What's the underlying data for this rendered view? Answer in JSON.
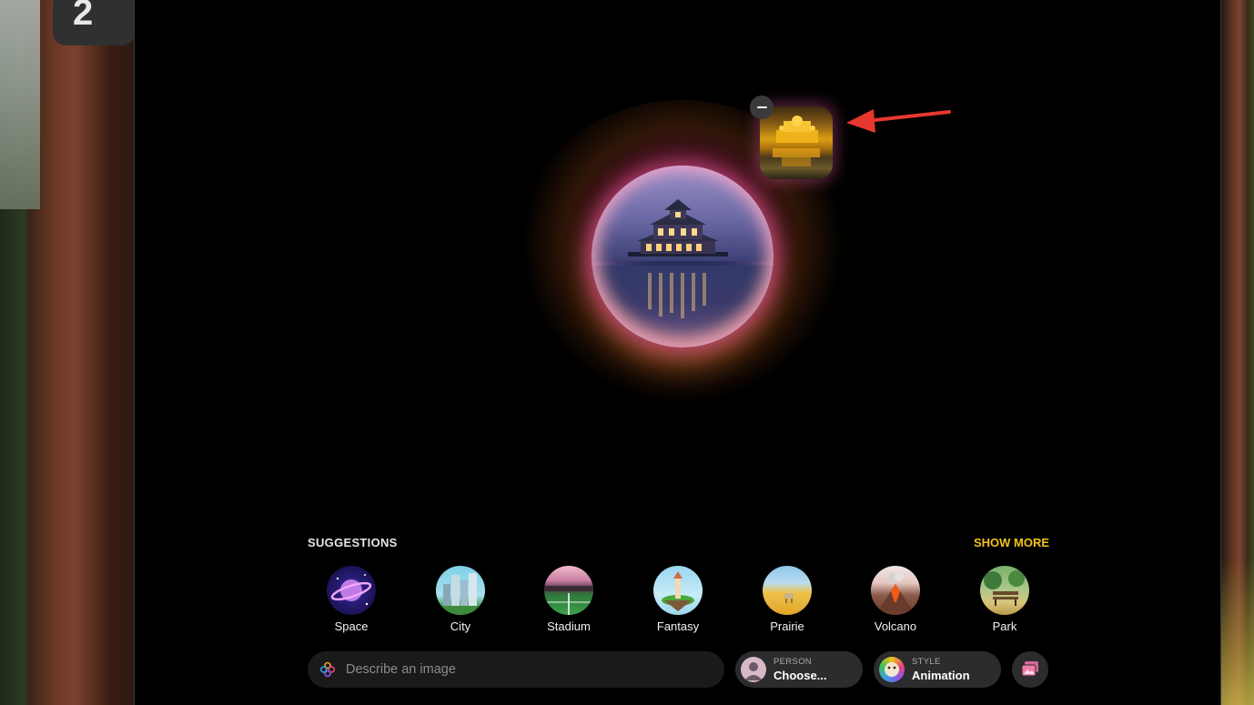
{
  "desktop": {
    "dock_tile_glyph": "2"
  },
  "composer": {
    "remove_reference_icon": "minus-icon",
    "reference_image_icon": "golden-temple-thumbnail"
  },
  "suggestions": {
    "heading": "SUGGESTIONS",
    "show_more_label": "SHOW MORE",
    "items": [
      {
        "label": "Space",
        "icon": "planet-icon"
      },
      {
        "label": "City",
        "icon": "city-icon"
      },
      {
        "label": "Stadium",
        "icon": "stadium-icon"
      },
      {
        "label": "Fantasy",
        "icon": "fantasy-island-icon"
      },
      {
        "label": "Prairie",
        "icon": "prairie-icon"
      },
      {
        "label": "Volcano",
        "icon": "volcano-icon"
      },
      {
        "label": "Park",
        "icon": "park-bench-icon"
      }
    ]
  },
  "prompt": {
    "placeholder": "Describe an image",
    "value": ""
  },
  "person_chip": {
    "caption": "PERSON",
    "value": "Choose..."
  },
  "style_chip": {
    "caption": "STYLE",
    "value": "Animation"
  },
  "gallery_button_icon": "photo-gallery-icon",
  "colors": {
    "accent_show_more": "#f2c21b",
    "annotation_arrow": "#e8372f",
    "glow_pink": "#ff5aa8",
    "glow_orange": "#ff9a3c"
  }
}
